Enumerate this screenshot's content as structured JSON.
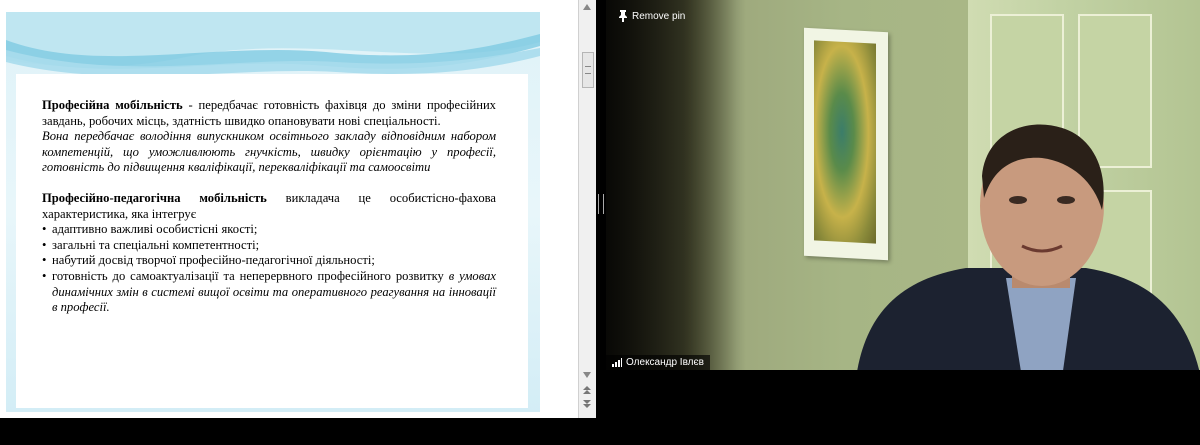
{
  "slide": {
    "p1_term": "Професійна мобільність",
    "p1_sep": " -  ",
    "p1_text": "передбачає готовність фахівця до зміни професійних завдань, робочих місць, здатність швидко опановувати нові спеціальності.",
    "p2_italic": "Вона передбачає володіння випускником освітнього закладу відповідним набором компетенцій, що уможливлюють гнучкість, швидку орієнтацію у професії, готовність до підвищення кваліфікації, перекваліфікації та самоосвіти",
    "p3_term": "Професійно-педагогічна мобільність",
    "p3_text": " викладача це особистісно-фахова характеристика, яка інтегрує",
    "bullets": [
      "адаптивно важливі особистісні якості;",
      "загальні та спеціальні компетентності;",
      "набутий досвід творчої професійно-педагогічної діяльності;"
    ],
    "bullet4_text": "готовність до самоактуалізації та неперервного професійного розвитку",
    "bullet4_italic": " в умовах динамічних змін в системі вищої освіти та оперативного реагування на інновації в професії."
  },
  "video": {
    "pin_label": "Remove pin",
    "participant_name": "Олександр Івлєв"
  },
  "icons": {
    "pin": "pin-icon",
    "signal": "signal-bars-icon"
  },
  "colors": {
    "slide_wave": "#8fd2e6",
    "background": "#000000"
  }
}
